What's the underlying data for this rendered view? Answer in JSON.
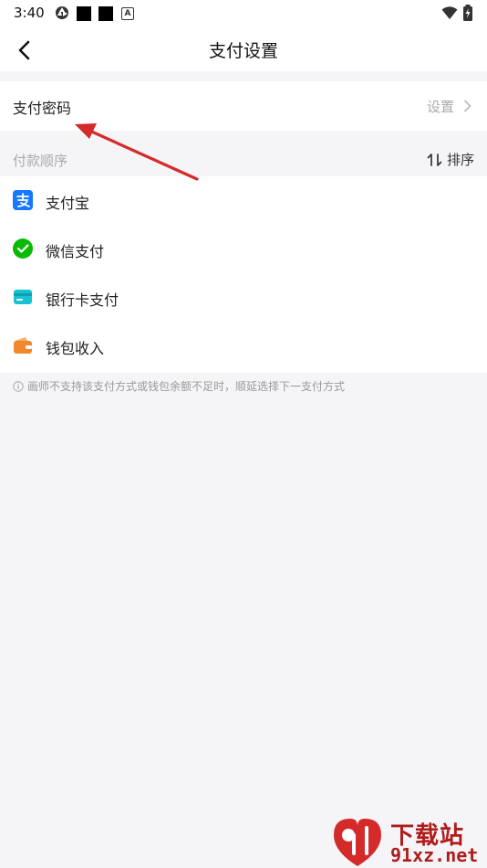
{
  "status_bar": {
    "time": "3:40"
  },
  "nav": {
    "title": "支付设置"
  },
  "password_row": {
    "label": "支付密码",
    "value": "设置"
  },
  "payment_order": {
    "title": "付款顺序",
    "sort_label": "排序",
    "items": [
      {
        "label": "支付宝",
        "icon": "alipay-icon",
        "color": "#1677ff"
      },
      {
        "label": "微信支付",
        "icon": "wechat-pay-icon",
        "color": "#09bb07"
      },
      {
        "label": "银行卡支付",
        "icon": "bank-card-icon",
        "color": "#19c2d3"
      },
      {
        "label": "钱包收入",
        "icon": "wallet-icon",
        "color": "#f0892e"
      }
    ]
  },
  "note": "画师不支持该支付方式或钱包余额不足时，顺延选择下一支付方式",
  "watermark": {
    "text": "下载站",
    "url": "91xz.net"
  },
  "colors": {
    "annotation_arrow": "#d42a2a",
    "watermark": "#b01b1b"
  }
}
